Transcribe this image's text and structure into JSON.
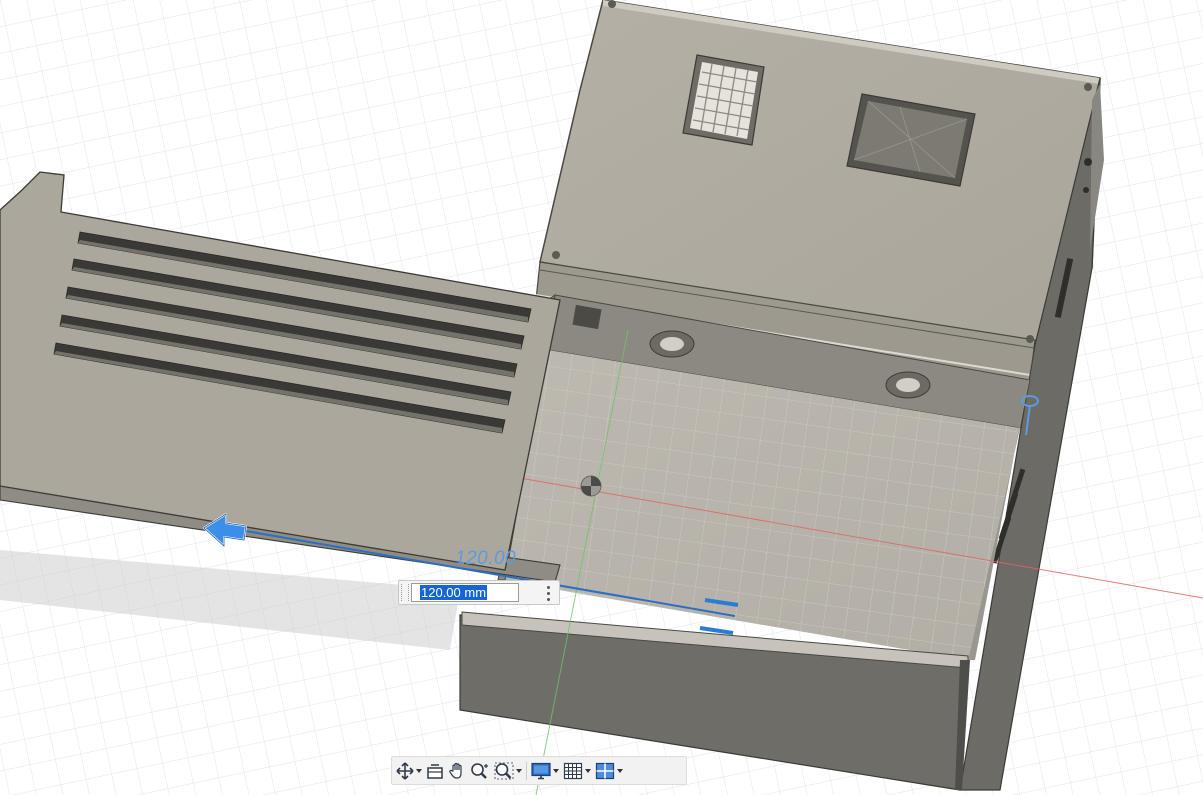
{
  "viewport": {
    "dimension_value_label": "120.00",
    "dimension_input": {
      "value": "120.00 mm",
      "selected": true
    }
  },
  "navigation_bar": {
    "items": [
      {
        "icon": "orbit-icon",
        "has_dropdown": true
      },
      {
        "icon": "look-at-icon",
        "has_dropdown": false
      },
      {
        "icon": "pan-icon",
        "has_dropdown": false
      },
      {
        "icon": "zoom-icon",
        "has_dropdown": false
      },
      {
        "icon": "zoom-window-icon",
        "has_dropdown": true
      },
      {
        "icon": "display-settings-icon",
        "has_dropdown": true
      },
      {
        "icon": "grid-snaps-icon",
        "has_dropdown": true
      },
      {
        "icon": "viewports-icon",
        "has_dropdown": true
      }
    ]
  },
  "colors": {
    "grid_line": "#e2e6ea",
    "body_gray": "#aaa69c",
    "dark_gray": "#6f6d67",
    "dimension_blue": "#2a7dd6",
    "x_axis": "#e05a5a",
    "y_axis": "#69c36a"
  }
}
